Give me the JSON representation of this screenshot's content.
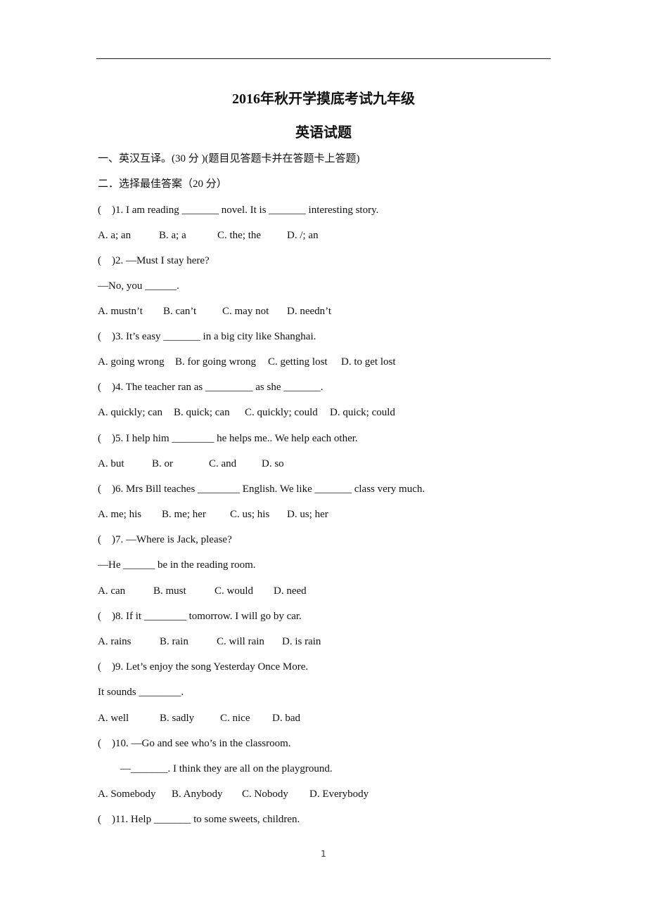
{
  "document": {
    "title": "2016年秋开学摸底考试九年级",
    "subtitle": "英语试题",
    "section1": "一、英汉互译。(30 分 )(题目见答题卡并在答题卡上答题)",
    "section2": "二．选择最佳答案（20 分）",
    "questions": [
      {
        "stem": [
          "(    )1. I am reading _______ novel. It is _______ interesting story."
        ],
        "options": [
          "A. a; an",
          "B. a; a",
          "C. the; the",
          "D. /; an"
        ]
      },
      {
        "stem": [
          "(    )2. —Must I stay here?",
          "—No, you ______."
        ],
        "options": [
          "A. mustn’t",
          "B. can’t",
          "C. may not",
          "D. needn’t"
        ]
      },
      {
        "stem": [
          "(    )3. It’s easy _______ in a big city like Shanghai."
        ],
        "options": [
          "A. going wrong",
          "B. for going wrong",
          "C. getting lost",
          "D. to get lost"
        ]
      },
      {
        "stem": [
          "(    )4. The teacher ran as _________ as she _______."
        ],
        "options": [
          "A. quickly; can",
          "B. quick; can",
          "C. quickly; could",
          "D. quick; could"
        ]
      },
      {
        "stem": [
          "(    )5. I help him ________ he helps me.. We help each other."
        ],
        "options": [
          "A. but",
          "B. or",
          "C. and",
          "D. so"
        ]
      },
      {
        "stem": [
          "(    )6. Mrs Bill teaches ________ English. We like _______ class very much."
        ],
        "options": [
          "A. me; his",
          "B. me; her",
          "C. us; his",
          "D. us; her"
        ]
      },
      {
        "stem": [
          "(    )7. —Where is Jack, please?",
          "—He ______ be in the reading room."
        ],
        "options": [
          "A. can",
          "B. must",
          "C. would",
          "D. need"
        ]
      },
      {
        "stem": [
          "(    )8. If it ________ tomorrow. I will go by car."
        ],
        "options": [
          "A. rains",
          "B. rain",
          "C. will rain",
          "D. is rain"
        ]
      },
      {
        "stem": [
          "(    )9. Let’s enjoy the song Yesterday Once More.",
          "It sounds ________."
        ],
        "options": [
          "A. well",
          "B. sadly",
          "C. nice",
          "D. bad"
        ]
      },
      {
        "stem": [
          "(    )10. —Go and see who’s in the classroom.",
          "—_______. I think they are all on the playground."
        ],
        "options": [
          "A. Somebody",
          "B. Anybody",
          "C. Nobody",
          "D. Everybody"
        ]
      },
      {
        "stem": [
          "(    )11. Help _______ to some sweets, children."
        ],
        "options": []
      }
    ],
    "page_number": "1"
  }
}
